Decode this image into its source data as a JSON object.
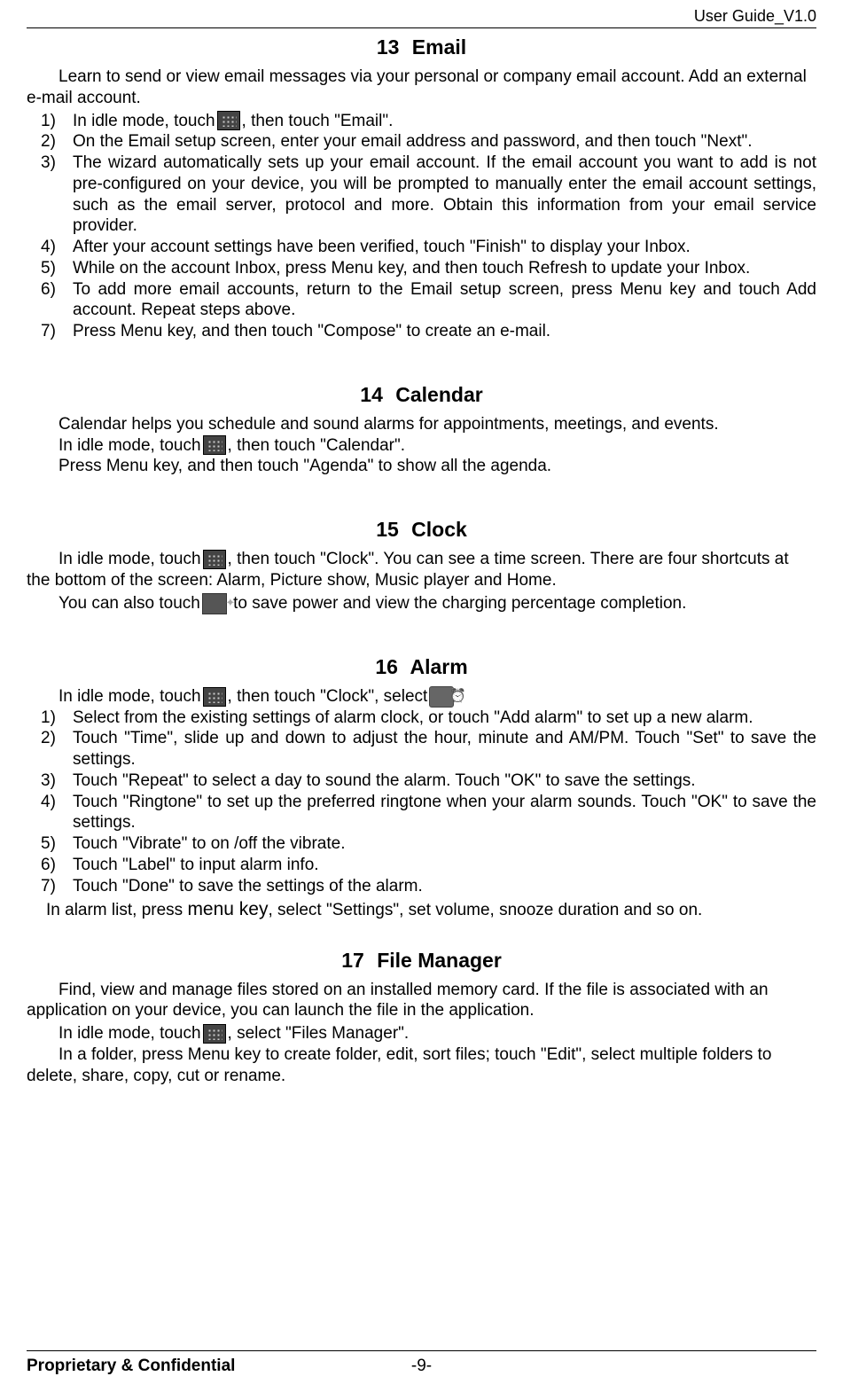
{
  "header": {
    "title": "User Guide_V1.0"
  },
  "sec13": {
    "num": "13",
    "title": "Email",
    "intro": "Learn to send or view email messages via your personal or company email account. Add an external e-mail account.",
    "items": [
      {
        "n": "1)",
        "pre": "In idle mode, touch",
        "post": ", then touch \"Email\"."
      },
      {
        "n": "2)",
        "text": "On the Email setup screen, enter your email address and password, and then touch \"Next\"."
      },
      {
        "n": "3)",
        "text": "The wizard automatically sets up your email account. If the email account you want to add is not pre-configured on your device, you will be prompted to manually enter the email account settings, such as the email server, protocol and more. Obtain this information from your email service provider."
      },
      {
        "n": "4)",
        "text": "After your account settings have been verified, touch \"Finish\" to display your Inbox."
      },
      {
        "n": "5)",
        "text": "While on the account Inbox, press Menu key, and then touch Refresh to update your Inbox."
      },
      {
        "n": "6)",
        "text": "To add more email accounts, return to the Email setup screen, press Menu key and touch Add account. Repeat steps above."
      },
      {
        "n": "7)",
        "text": "Press Menu key, and then touch \"Compose\" to create an e-mail."
      }
    ]
  },
  "sec14": {
    "num": "14",
    "title": "Calendar",
    "p1": "Calendar helps you schedule and sound alarms for appointments, meetings, and events.",
    "p2_pre": "In idle mode, touch",
    "p2_post": ", then touch \"Calendar\".",
    "p3": "Press Menu key, and then touch \"Agenda\" to show all the agenda."
  },
  "sec15": {
    "num": "15",
    "title": "Clock",
    "p1_pre": "In idle mode, touch",
    "p1_post": ", then touch \"Clock\". You can see a time screen. There are four shortcuts at the bottom of the screen: Alarm, Picture show, Music player and Home.",
    "p2_pre": "You can also touch",
    "p2_post": " to save power and view the charging percentage completion."
  },
  "sec16": {
    "num": "16",
    "title": "Alarm",
    "p1_pre": "In idle mode, touch",
    "p1_mid": ", then touch \"Clock\", select",
    "p1_post": ".",
    "items": [
      {
        "n": "1)",
        "text": "Select from the existing settings of alarm clock, or touch \"Add alarm\" to set up a new alarm."
      },
      {
        "n": "2)",
        "text": "Touch \"Time\", slide up and down to adjust the hour, minute and AM/PM. Touch \"Set\" to save the settings."
      },
      {
        "n": "3)",
        "text": "Touch \"Repeat\" to select a day to sound the alarm. Touch \"OK\" to save the settings."
      },
      {
        "n": "4)",
        "text": "Touch \"Ringtone\" to set up the preferred ringtone when your alarm sounds. Touch \"OK\" to save the settings."
      },
      {
        "n": "5)",
        "text": "Touch \"Vibrate\" to on /off the vibrate."
      },
      {
        "n": "6)",
        "text": "Touch \"Label\" to input alarm info."
      },
      {
        "n": "7)",
        "text": "Touch \"Done\" to save the settings of the alarm."
      }
    ],
    "p_settings_a": "In alarm list, press ",
    "p_settings_menu": "menu key",
    "p_settings_b": ", select \"Settings\", set volume, snooze duration and so on."
  },
  "sec17": {
    "num": "17",
    "title": "File Manager",
    "p1": "Find, view and manage files stored on an installed memory card. If the file is associated with an application on your device, you can launch the file in the application.",
    "p2_pre": "In idle mode, touch",
    "p2_post": ", select \"Files Manager\".",
    "p3": "In a folder, press Menu key to create folder, edit, sort files; touch \"Edit\", select multiple folders to delete, share, copy, cut or rename."
  },
  "footer": {
    "prop": "Proprietary & Confidential",
    "page": "-9-"
  }
}
